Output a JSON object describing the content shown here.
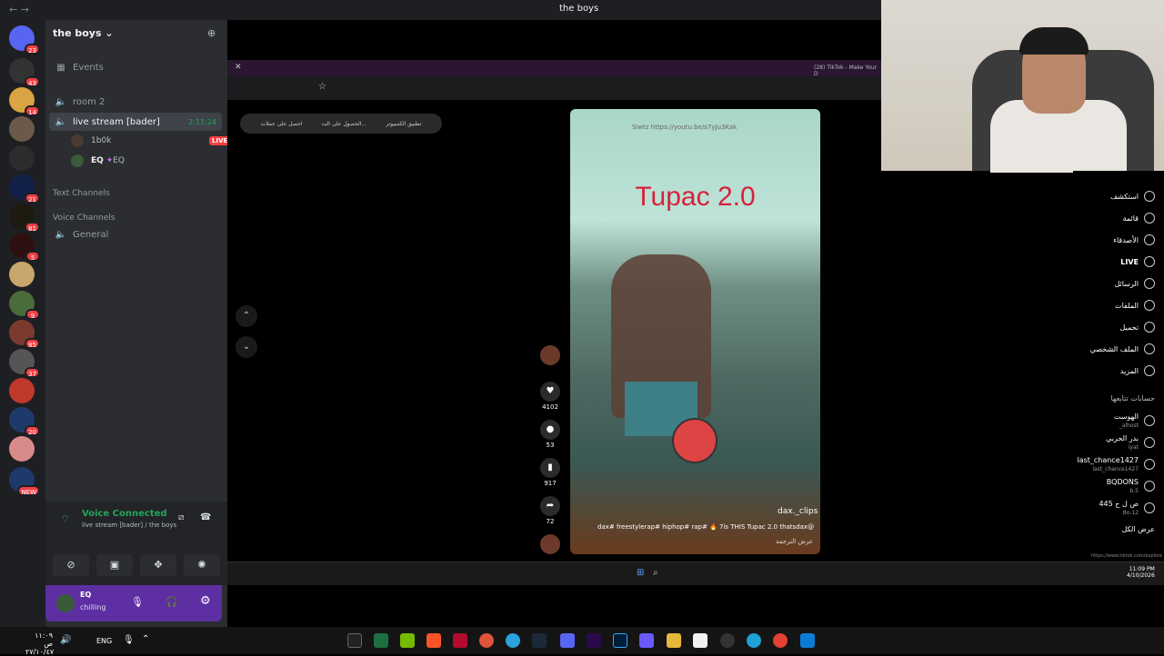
{
  "window": {
    "title": "the boys",
    "back": "←",
    "fwd": "→"
  },
  "servers": [
    {
      "badge": "23"
    },
    {
      "badge": "43"
    },
    {
      "badge": "14"
    },
    {
      "badge": ""
    },
    {
      "badge": ""
    },
    {
      "badge": "21"
    },
    {
      "badge": "81"
    },
    {
      "badge": "5"
    },
    {
      "badge": ""
    },
    {
      "badge": "9"
    },
    {
      "badge": "85"
    },
    {
      "badge": "37"
    },
    {
      "badge": ""
    },
    {
      "badge": "20"
    },
    {
      "badge": ""
    },
    {
      "badge": "NEW"
    }
  ],
  "guild": {
    "name": "the boys",
    "chev": "⌄"
  },
  "channels": {
    "events": "Events",
    "room2": "room 2",
    "live_stream": "live stream [bader]",
    "timer": "2:11:24",
    "member1": "1b0k",
    "live_badge": "LIVE",
    "member2": "EQ",
    "member2_tag": "EQ",
    "text_channels": "Text Channels",
    "voice_channels": "Voice Channels",
    "general": "General"
  },
  "voice": {
    "status": "Voice Connected",
    "location": "live stream [bader] / the boys"
  },
  "user": {
    "name": "EQ",
    "status": "chilling"
  },
  "browser": {
    "tab_title": "(28) TikTok - Make Your D",
    "pill1": "احصل على عملات",
    "pill2": "الحصول على الت...",
    "pill3": "تطبيق الكمبيوتر"
  },
  "video": {
    "title": "Tupac 2.0",
    "url": "Siwtz https://youtu.be/s7yJu3Kak",
    "author": "dax._clips",
    "caption": "dax# freestylerap# hiphop# rap# 🔥 7is THIS Tupac 2.0 thatsdax@",
    "more": "عرض الترجمة"
  },
  "actions": {
    "likes": "4102",
    "comments": "53",
    "saves": "917",
    "shares": "72"
  },
  "tiktok_nav": [
    {
      "label": "استكشف"
    },
    {
      "label": "قائمة"
    },
    {
      "label": "الأصدقاء"
    },
    {
      "label": "LIVE"
    },
    {
      "label": "الرسائل"
    },
    {
      "label": "الملفات"
    },
    {
      "label": "تحميل"
    },
    {
      "label": "الملف الشخصي"
    },
    {
      "label": "المزيد"
    }
  ],
  "following": {
    "heading": "حسابات تتابعها",
    "accounts": [
      {
        "name": "الهوست",
        "handle": "_alhost"
      },
      {
        "name": "بدر الحربي",
        "handle": "iyat"
      },
      {
        "name": "last_chance1427",
        "handle": "last_chance1427"
      },
      {
        "name": "BQDONS",
        "handle": "b.5"
      },
      {
        "name": "ص ل ح 445",
        "handle": "Bo.12"
      }
    ],
    "see_all": "عرض الكل"
  },
  "statusurl": "https://www.tiktok.com/explore",
  "inner_clock": {
    "time": "11:09 PM",
    "date": "4/10/2026"
  },
  "taskbar": {
    "lang": "ENG",
    "clock1": "١١:٠٩ ص",
    "clock2": "٢٧/١٠/٤٧"
  }
}
